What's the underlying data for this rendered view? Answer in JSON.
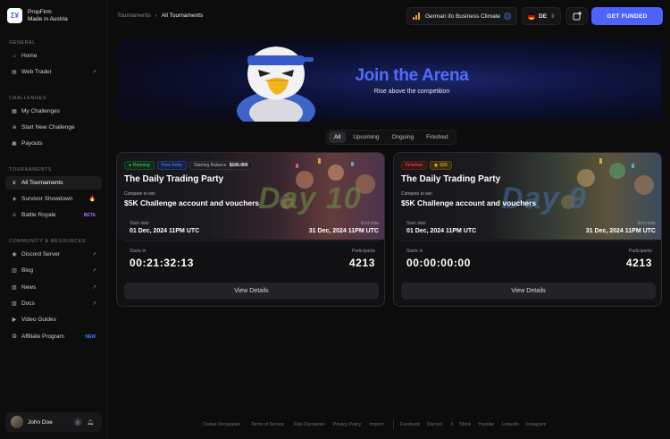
{
  "brand": {
    "line1": "PropFirm",
    "line2": "Made in Austria",
    "logo": "Σ¥"
  },
  "sidebar": {
    "general_title": "GENERAL",
    "general": [
      {
        "label": "Home",
        "icon": "home-icon"
      },
      {
        "label": "Web Trader",
        "icon": "terminal-icon"
      }
    ],
    "challenges_title": "CHALLENGES",
    "challenges": [
      {
        "label": "My Challenges",
        "icon": "list-icon"
      },
      {
        "label": "Start New Challenge",
        "icon": "plus-circle-icon"
      },
      {
        "label": "Payouts",
        "icon": "wallet-icon"
      }
    ],
    "tournaments_title": "TOURNAMENTS",
    "tournaments": [
      {
        "label": "All Tournaments",
        "icon": "trophy-icon"
      },
      {
        "label": "Survivor Showdown",
        "icon": "shield-icon",
        "tag": "🔥"
      },
      {
        "label": "Battle Royale",
        "icon": "swords-icon",
        "tag": "BETA"
      }
    ],
    "community_title": "COMMUNITY & RESOURCES",
    "community": [
      {
        "label": "Discord Server",
        "icon": "discord-icon"
      },
      {
        "label": "Blog",
        "icon": "blog-icon"
      },
      {
        "label": "News",
        "icon": "news-icon"
      },
      {
        "label": "Docs",
        "icon": "docs-icon"
      },
      {
        "label": "Video Guides",
        "icon": "video-icon"
      },
      {
        "label": "Affiliate Program",
        "icon": "affiliate-icon",
        "tag": "NEW"
      }
    ],
    "user": {
      "name": "John Doe"
    }
  },
  "topbar": {
    "breadcrumb_parent": "Tournaments",
    "breadcrumb_sep": "›",
    "breadcrumb_current": "All Tournaments",
    "ticker": "German ifo Business Climate",
    "language": "DE",
    "cta": "GET FUNDED"
  },
  "hero": {
    "title": "Join the Arena",
    "subtitle": "Rise above the competition"
  },
  "filters": {
    "tabs": [
      "All",
      "Upcoming",
      "Ongoing",
      "Finished"
    ],
    "active": "All"
  },
  "cards": [
    {
      "status": "Running",
      "entry": "Free Entry",
      "balance_label": "Starting Balance",
      "balance_value": "$100.000",
      "title": "The Daily Trading Party",
      "compete_label": "Compete to win",
      "prize": "$5K Challenge account and vouchers",
      "day_art": "Day 10",
      "start_label": "Start date",
      "start_value": "01 Dec, 2024 11PM UTC",
      "end_label": "End date",
      "end_value": "31 Dec, 2024 11PM UTC",
      "countdown_label": "Starts in",
      "countdown": "00:21:32:13",
      "participants_label": "Participants",
      "participants": "4213",
      "button": "View Details"
    },
    {
      "status": "Finished",
      "fee": "500",
      "title": "The Daily Trading Party",
      "compete_label": "Compete to win",
      "prize": "$5K Challenge account and vouchers",
      "day_art": "Day 9",
      "start_label": "Start date",
      "start_value": "01 Dec, 2024 11PM UTC",
      "end_label": "End date",
      "end_value": "31 Dec, 2024 11PM UTC",
      "countdown_label": "Starts in",
      "countdown": "00:00:00:00",
      "participants_label": "Participants",
      "participants": "4213",
      "button": "View Details"
    }
  ],
  "footer": {
    "legal": [
      "Cookie Declaration",
      "Terms of Service",
      "Risk Disclaimer",
      "Privacy Policy",
      "Imprint"
    ],
    "social": [
      "Facebook",
      "Discord",
      "X",
      "Tiktok",
      "Youtube",
      "LinkedIn",
      "Instagram"
    ]
  },
  "colors": {
    "accent": "#4d62ff",
    "running": "#3ed86b",
    "finished": "#ff5c5c",
    "new": "#4c7dff",
    "beta": "#a56bff"
  }
}
